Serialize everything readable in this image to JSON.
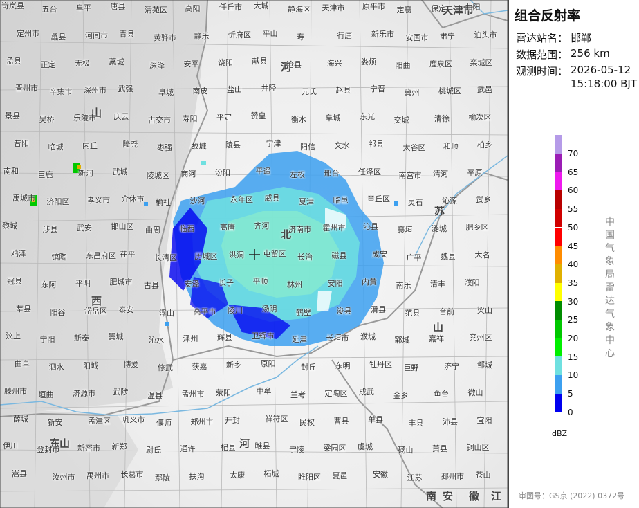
{
  "panel": {
    "title": "组合反射率",
    "station_label": "雷达站名：",
    "station_value": "邯郸",
    "range_label": "数据范围：",
    "range_value": "256 km",
    "time_label": "观测时间：",
    "time_date": "2026-05-12",
    "time_clock": "15:18:00 BJT",
    "unit": "dBZ",
    "agency": "中国气象局雷达气象中心",
    "review_no": "审图号：GS京 (2022) 0372号"
  },
  "legend": {
    "levels": [
      {
        "label": "70",
        "color": "#b59be8"
      },
      {
        "label": "65",
        "color": "#9b1db5"
      },
      {
        "label": "60",
        "color": "#ee19ee"
      },
      {
        "label": "55",
        "color": "#b80000"
      },
      {
        "label": "50",
        "color": "#d00000"
      },
      {
        "label": "45",
        "color": "#ff0000"
      },
      {
        "label": "40",
        "color": "#ff8c00"
      },
      {
        "label": "35",
        "color": "#e0b000"
      },
      {
        "label": "30",
        "color": "#ffff00"
      },
      {
        "label": "25",
        "color": "#008c00"
      },
      {
        "label": "20",
        "color": "#00c800"
      },
      {
        "label": "15",
        "color": "#00f000"
      },
      {
        "label": "10",
        "color": "#6fe0e0"
      },
      {
        "label": "5",
        "color": "#3ca0f0"
      },
      {
        "label": "0",
        "color": "#0000f0"
      }
    ]
  },
  "map": {
    "provinces": [
      "天津市",
      "河",
      "北",
      "山",
      "西",
      "山",
      "东",
      "河",
      "南",
      "安",
      "徽",
      "江",
      "苏",
      "山"
    ],
    "places": [
      "岢岚县",
      "五台",
      "阜平",
      "唐县",
      "清苑区",
      "高阳",
      "任丘市",
      "大城",
      "静海区",
      "天津市",
      "原平市",
      "定襄",
      "保定",
      "曲阳",
      "定州市",
      "蠡县",
      "河间市",
      "青县",
      "黄骅市",
      "静乐",
      "忻府区",
      "平山",
      "寿",
      "行唐",
      "新乐市",
      "安国市",
      "肃宁",
      "泊头市",
      "孟县",
      "正定",
      "无极",
      "藁城",
      "深泽",
      "安平",
      "饶阳",
      "献县",
      "沧县",
      "海兴",
      "娄烦",
      "阳曲",
      "鹿泉区",
      "栾城区",
      "晋州市",
      "辛集市",
      "深州市",
      "武强",
      "阜城",
      "南皮",
      "盐山",
      "井陉",
      "元氏",
      "赵县",
      "宁晋",
      "冀州",
      "桃城区",
      "武邑",
      "景县",
      "吴桥",
      "乐陵市",
      "庆云",
      "古交市",
      "寿阳",
      "平定",
      "赞皇",
      "衡水",
      "阜城",
      "东光",
      "交城",
      "清徐",
      "榆次区",
      "昔阳",
      "临城",
      "内丘",
      "隆尧",
      "枣强",
      "故城",
      "陵县",
      "宁津",
      "阳信",
      "文水",
      "祁县",
      "太谷区",
      "和顺",
      "柏乡",
      "南和",
      "巨鹿",
      "新河",
      "武城",
      "陵城区",
      "商河",
      "汾阳",
      "平遥",
      "左权",
      "邢台",
      "任泽区",
      "南宫市",
      "清河",
      "平原",
      "禹城市",
      "济阳区",
      "孝义市",
      "介休市",
      "榆社",
      "沙河",
      "永年区",
      "威县",
      "夏津",
      "临邑",
      "章丘区",
      "灵石",
      "沁源",
      "武乡",
      "黎城",
      "涉县",
      "武安",
      "邯山区",
      "曲周",
      "临西",
      "高唐",
      "齐河",
      "济南市",
      "霍州市",
      "沁县",
      "襄垣",
      "潞城",
      "肥乡区",
      "鸡泽",
      "馆陶",
      "东昌府区",
      "茌平",
      "长清区",
      "历城区",
      "洪洞",
      "屯留区",
      "长治",
      "磁县",
      "成安",
      "广平",
      "魏县",
      "大名",
      "冠县",
      "东阿",
      "平阴",
      "肥城市",
      "古县",
      "安泽",
      "长子",
      "平顺",
      "林州",
      "安阳",
      "内黄",
      "南乐",
      "清丰",
      "濮阳",
      "莘县",
      "阳谷",
      "岱岳区",
      "泰安",
      "浮山",
      "高平市",
      "陵川",
      "汤阴",
      "鹤壁",
      "浚县",
      "滑县",
      "范县",
      "台前",
      "梁山",
      "汶上",
      "宁阳",
      "新泰",
      "翼城",
      "沁水",
      "泽州",
      "辉县",
      "卫辉市",
      "延津",
      "长垣市",
      "濮城",
      "郓城",
      "嘉祥",
      "兖州区",
      "曲阜",
      "泗水",
      "阳城",
      "博爱",
      "修武",
      "获嘉",
      "新乡",
      "原阳",
      "封丘",
      "东明",
      "牡丹区",
      "巨野",
      "济宁",
      "邹城",
      "滕州市",
      "垣曲",
      "济源市",
      "武陟",
      "温县",
      "孟州市",
      "荥阳",
      "中牟",
      "兰考",
      "定陶区",
      "成武",
      "金乡",
      "鱼台",
      "微山",
      "薛城",
      "新安",
      "孟津区",
      "巩义市",
      "偃师",
      "郑州市",
      "开封",
      "祥符区",
      "民权",
      "曹县",
      "单县",
      "丰县",
      "沛县",
      "宜阳",
      "伊川",
      "登封市",
      "新密市",
      "新郑",
      "尉氏",
      "通许",
      "杞县",
      "睢县",
      "宁陵",
      "梁园区",
      "虞城",
      "砀山",
      "萧县",
      "铜山区",
      "嵩县",
      "汝州市",
      "禹州市",
      "长葛市",
      "鄢陵",
      "扶沟",
      "太康",
      "柘城",
      "睢阳区",
      "夏邑",
      "安徽",
      "江苏",
      "邳州市",
      "苍山"
    ]
  }
}
